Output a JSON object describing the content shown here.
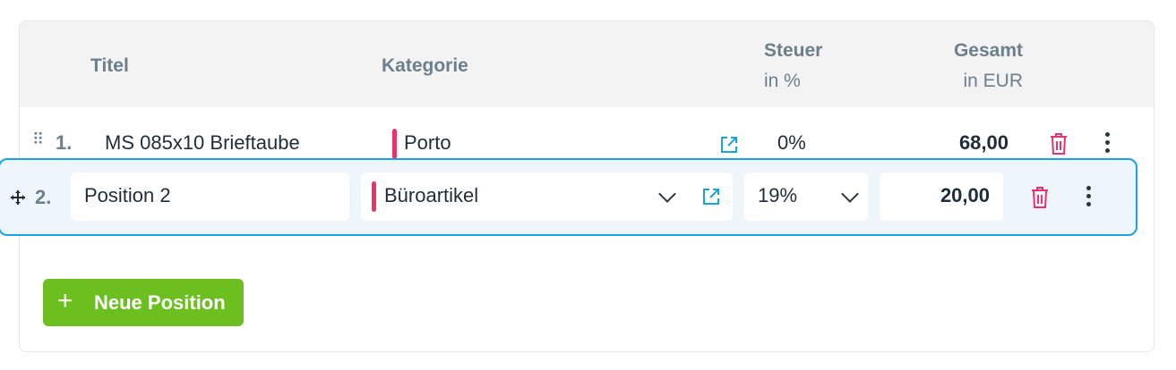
{
  "table": {
    "headers": {
      "title": "Titel",
      "category": "Kategorie",
      "tax": "Steuer",
      "tax_unit": "in %",
      "total": "Gesamt",
      "total_unit": "in EUR"
    },
    "rows": [
      {
        "index": "1.",
        "title": "MS 085x10 Brieftaube",
        "category": "Porto",
        "tax": "0%",
        "total": "68,00"
      },
      {
        "index": "2.",
        "title": "Position 2",
        "category": "Büroartikel",
        "tax": "19%",
        "total": "20,00"
      }
    ]
  },
  "actions": {
    "new_position": "Neue Position"
  },
  "colors": {
    "accent": "#1aa3e0",
    "category_bar": "#e8336b",
    "delete": "#e8336b",
    "add_button": "#6bbf1f"
  },
  "icons": [
    "drag-handle-icon",
    "external-link-icon",
    "trash-icon",
    "more-vertical-icon",
    "chevron-down-icon",
    "plus-icon",
    "move-cursor-icon"
  ]
}
